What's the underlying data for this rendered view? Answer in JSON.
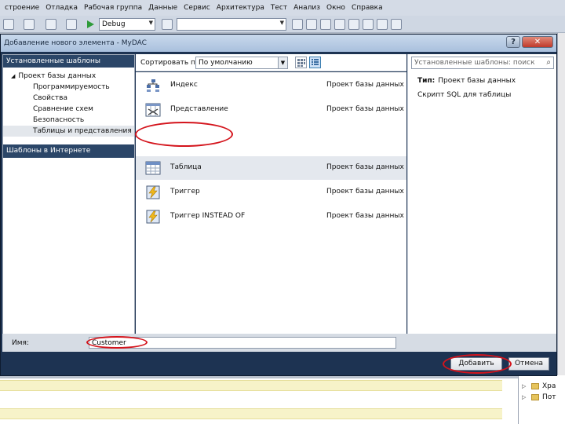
{
  "menubar": {
    "items": [
      "строение",
      "Отладка",
      "Рабочая группа",
      "Данные",
      "Сервис",
      "Архитектура",
      "Тест",
      "Анализ",
      "Окно",
      "Справка"
    ]
  },
  "toolbar": {
    "config_value": "Debug"
  },
  "dialog": {
    "title": "Добавление нового элемента - MyDAC",
    "help_label": "?",
    "close_label": "✕",
    "left": {
      "installed_header": "Установленные шаблоны",
      "tree": [
        {
          "label": "Проект базы данных",
          "level": 0,
          "expanded": true
        },
        {
          "label": "Программируемость",
          "level": 1
        },
        {
          "label": "Свойства",
          "level": 1
        },
        {
          "label": "Сравнение схем",
          "level": 1
        },
        {
          "label": "Безопасность",
          "level": 1
        },
        {
          "label": "Таблицы и представления",
          "level": 1,
          "selected": true
        }
      ],
      "online_header": "Шаблоны в Интернете"
    },
    "sort": {
      "label": "Сортировать по:",
      "value": "По умолчанию"
    },
    "templates": [
      {
        "name": "Индекс",
        "category": "Проект базы данных",
        "icon": "index-icon"
      },
      {
        "name": "Представление",
        "category": "Проект базы данных",
        "icon": "view-icon"
      },
      {
        "name": "Таблица",
        "category": "Проект базы данных",
        "icon": "table-icon",
        "selected": true
      },
      {
        "name": "Триггер",
        "category": "Проект базы данных",
        "icon": "trigger-icon"
      },
      {
        "name": "Триггер INSTEAD OF",
        "category": "Проект базы данных",
        "icon": "trigger-icon"
      }
    ],
    "search": {
      "placeholder": "Установленные шаблоны: поиск"
    },
    "details": {
      "type_label": "Тип:",
      "type_value": "Проект базы данных",
      "description": "Скрипт SQL для таблицы"
    },
    "name_field": {
      "label": "Имя:",
      "value": "Customer"
    },
    "buttons": {
      "add": "Добавить",
      "cancel": "Отмена"
    }
  },
  "solution_explorer": {
    "items": [
      "Хра",
      "Пот"
    ]
  },
  "colors": {
    "dialog_frame": "#1d3352",
    "header_blue": "#2b4668",
    "annotation_red": "#d4141c"
  }
}
